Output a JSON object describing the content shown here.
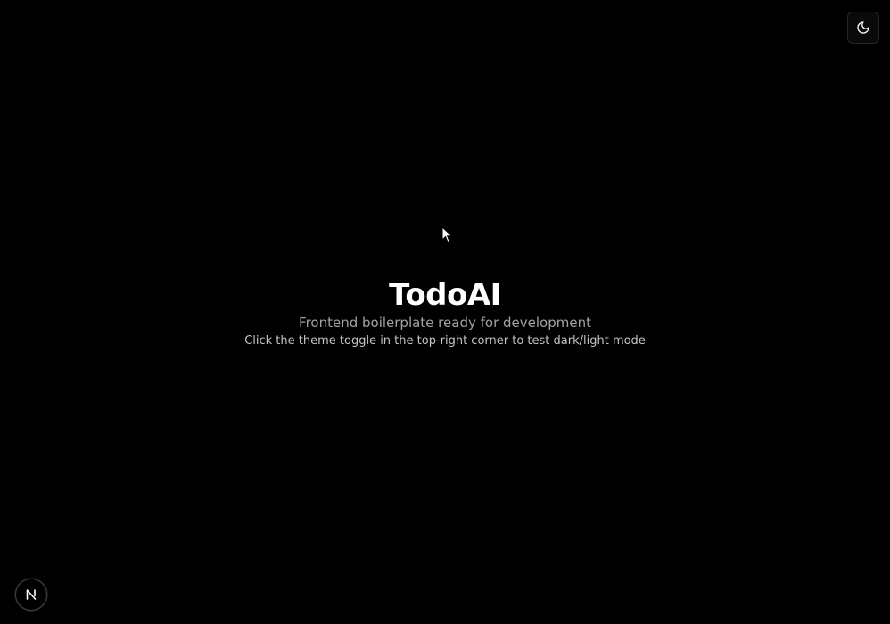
{
  "app": {
    "title": "TodoAI",
    "subtitle": "Frontend boilerplate ready for development",
    "hint": "Click the theme toggle in the top-right corner to test dark/light mode"
  },
  "theme_toggle": {
    "icon": "moon-icon",
    "mode": "dark"
  },
  "dev_badge": {
    "icon": "nextjs-icon",
    "letter": "N"
  },
  "colors": {
    "background": "#000000",
    "title": "#ffffff",
    "subtitle": "#a1a1aa",
    "hint": "#c4c4c8",
    "border": "#27272a"
  }
}
